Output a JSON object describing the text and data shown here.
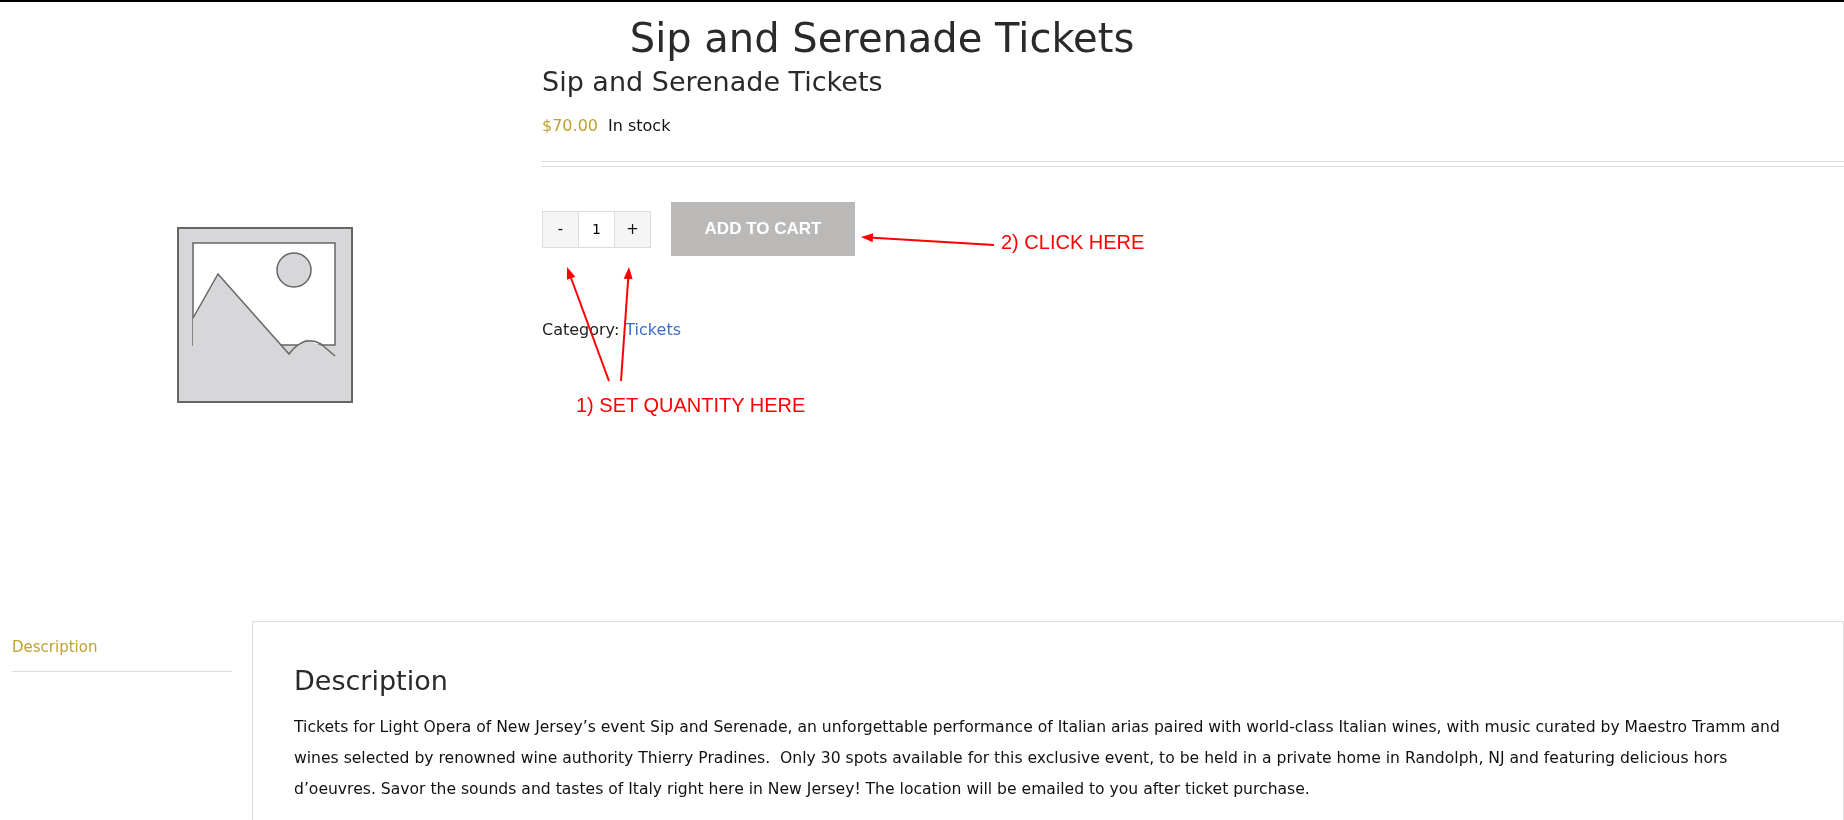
{
  "page_title": "Sip and Serenade Tickets",
  "product": {
    "title": "Sip and Serenade Tickets",
    "price": "$70.00",
    "stock": "In stock",
    "quantity": {
      "minus": "-",
      "value": "1",
      "plus": "+"
    },
    "add_to_cart": "ADD TO CART",
    "category_label": "Category:",
    "category": "Tickets"
  },
  "annotations": [
    {
      "text": "1) SET QUANTITY HERE"
    },
    {
      "text": "2) CLICK HERE"
    }
  ],
  "tabs": [
    {
      "label": "Description",
      "selected": true
    }
  ],
  "description": {
    "heading": "Description",
    "text": "Tickets for Light Opera of New Jersey’s event Sip and Serenade, an unforgettable performance of Italian arias paired with world-class Italian wines, with music curated by Maestro Tramm and wines selected by renowned wine authority Thierry Pradines.  Only 30 spots available for this exclusive event, to be held in a private home in Randolph, NJ and featuring delicious hors d’oeuvres. Savor the sounds and tastes of Italy right here in New Jersey! The location will be emailed to you after ticket purchase."
  }
}
